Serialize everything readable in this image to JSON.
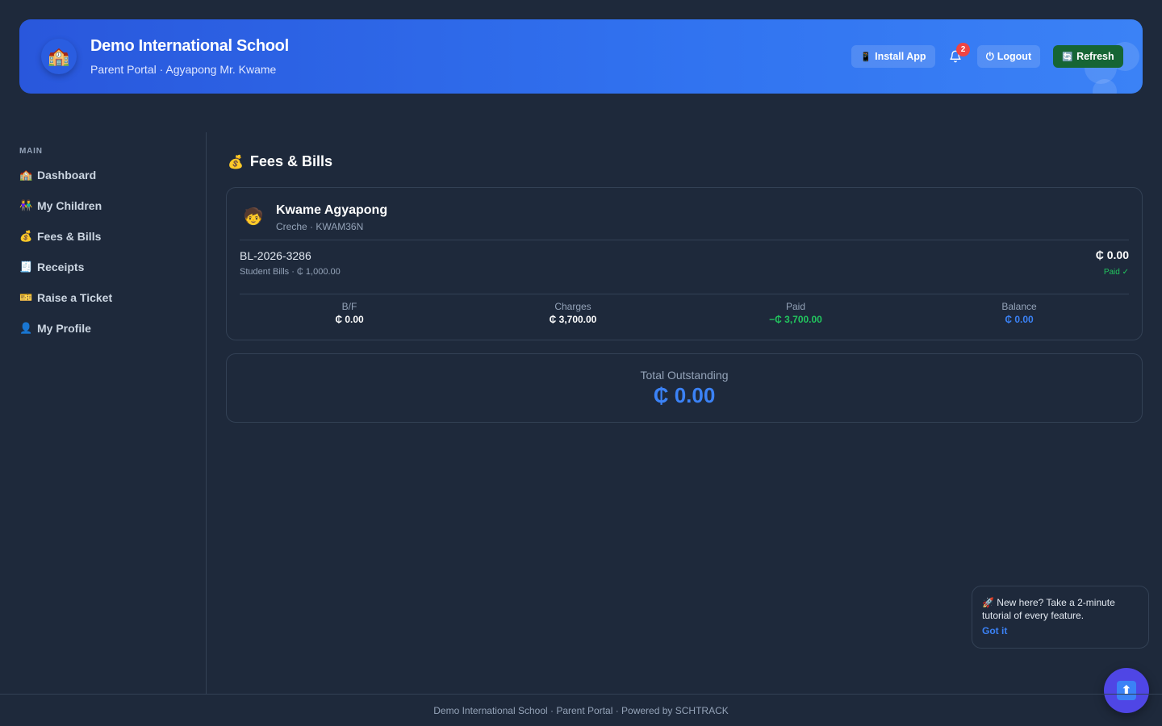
{
  "header": {
    "logo_icon": "school-building-icon",
    "school_name": "Demo International School",
    "subtitle": "Parent Portal · Agyapong Mr. Kwame",
    "install_label": "Install App",
    "notification_count": "2",
    "logout_label": "Logout",
    "refresh_label": "Refresh"
  },
  "sidebar": {
    "heading": "MAIN",
    "items": [
      {
        "label": "Dashboard",
        "icon": "🏫"
      },
      {
        "label": "My Children",
        "icon": "👫"
      },
      {
        "label": "Fees & Bills",
        "icon": "💰"
      },
      {
        "label": "Receipts",
        "icon": "🧾"
      },
      {
        "label": "Raise a Ticket",
        "icon": "🎫"
      },
      {
        "label": "My Profile",
        "icon": "👤"
      }
    ]
  },
  "main": {
    "title_icon": "💰",
    "title": "Fees & Bills",
    "child": {
      "avatar": "🧒",
      "name": "Kwame Agyapong",
      "sub": "Creche · KWAM36N"
    },
    "bill": {
      "number": "BL-2026-3286",
      "sub": "Student Bills · ₵ 1,000.00",
      "amount": "₵ 0.00",
      "status": "Paid ✓"
    },
    "stats": [
      {
        "label": "B/F",
        "value": "₵ 0.00",
        "color": "#ffffff"
      },
      {
        "label": "Charges",
        "value": "₵ 3,700.00",
        "color": "#ffffff"
      },
      {
        "label": "Paid",
        "value": "−₵ 3,700.00",
        "color": "#22c55e"
      },
      {
        "label": "Balance",
        "value": "₵ 0.00",
        "color": "#3b82f6"
      }
    ],
    "total": {
      "label": "Total Outstanding",
      "value": "₵ 0.00"
    }
  },
  "toast": {
    "text": "🚀 New here? Take a 2-minute tutorial of every feature.",
    "action": "Got it"
  },
  "fab": {
    "icon": "⬆"
  },
  "footer": {
    "text": "Demo International School · Parent Portal · Powered by SCHTRACK"
  },
  "colors": {
    "background": "#1e293b",
    "header_start": "#2957dc",
    "header_end": "#3b82f6",
    "accent": "#3b82f6",
    "success": "#22c55e",
    "refresh_button": "#166534",
    "badge": "#ef4444"
  }
}
